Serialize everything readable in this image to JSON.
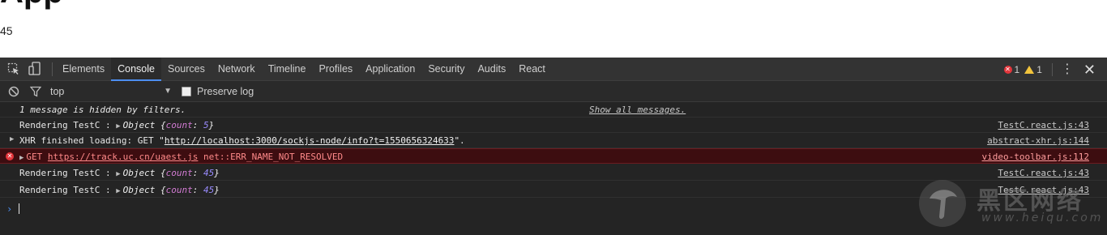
{
  "page": {
    "heading": "App",
    "counter": "45"
  },
  "toolbar": {
    "tabs": [
      {
        "label": "Elements",
        "active": false
      },
      {
        "label": "Console",
        "active": true
      },
      {
        "label": "Sources",
        "active": false
      },
      {
        "label": "Network",
        "active": false
      },
      {
        "label": "Timeline",
        "active": false
      },
      {
        "label": "Profiles",
        "active": false
      },
      {
        "label": "Application",
        "active": false
      },
      {
        "label": "Security",
        "active": false
      },
      {
        "label": "Audits",
        "active": false
      },
      {
        "label": "React",
        "active": false
      }
    ],
    "error_count": "1",
    "warning_count": "1",
    "icons": [
      "inspect-element-icon",
      "device-mode-icon",
      "error-icon",
      "warning-icon",
      "more-options-icon",
      "close-icon"
    ]
  },
  "filterbar": {
    "context": "top",
    "preserve_log_label": "Preserve log",
    "preserve_log_checked": false,
    "icons": [
      "clear-console-icon",
      "filter-icon",
      "dropdown-arrow-icon"
    ]
  },
  "console": {
    "hidden_note": "1 message is hidden by filters.",
    "show_all": "Show all messages.",
    "rows": [
      {
        "prefix": "Rendering TestC : ",
        "object_label": "Object",
        "key": "count",
        "value": "5",
        "source": "TestC.react.js:43"
      },
      {
        "prefix": "XHR finished loading: GET \"",
        "url": "http://localhost:3000/sockjs-node/info?t=1550656324633",
        "suffix": "\".",
        "source": "abstract-xhr.js:144"
      },
      {
        "prefix": "GET ",
        "url": "https://track.uc.cn/uaest.js",
        "suffix": " net::ERR_NAME_NOT_RESOLVED",
        "source": "video-toolbar.js:112"
      },
      {
        "prefix": "Rendering TestC : ",
        "object_label": "Object",
        "key": "count",
        "value": "45",
        "source": "TestC.react.js:43"
      },
      {
        "prefix": "Rendering TestC : ",
        "object_label": "Object",
        "key": "count",
        "value": "45",
        "source": "TestC.react.js:43"
      }
    ],
    "prompt": "›"
  },
  "watermark": {
    "text": "黑区网络",
    "url": "www.heiqu.com"
  },
  "colors": {
    "accent": "#4d8ef0",
    "error": "#e4363c",
    "warning": "#f2c43c",
    "panel_bg": "#242424"
  }
}
